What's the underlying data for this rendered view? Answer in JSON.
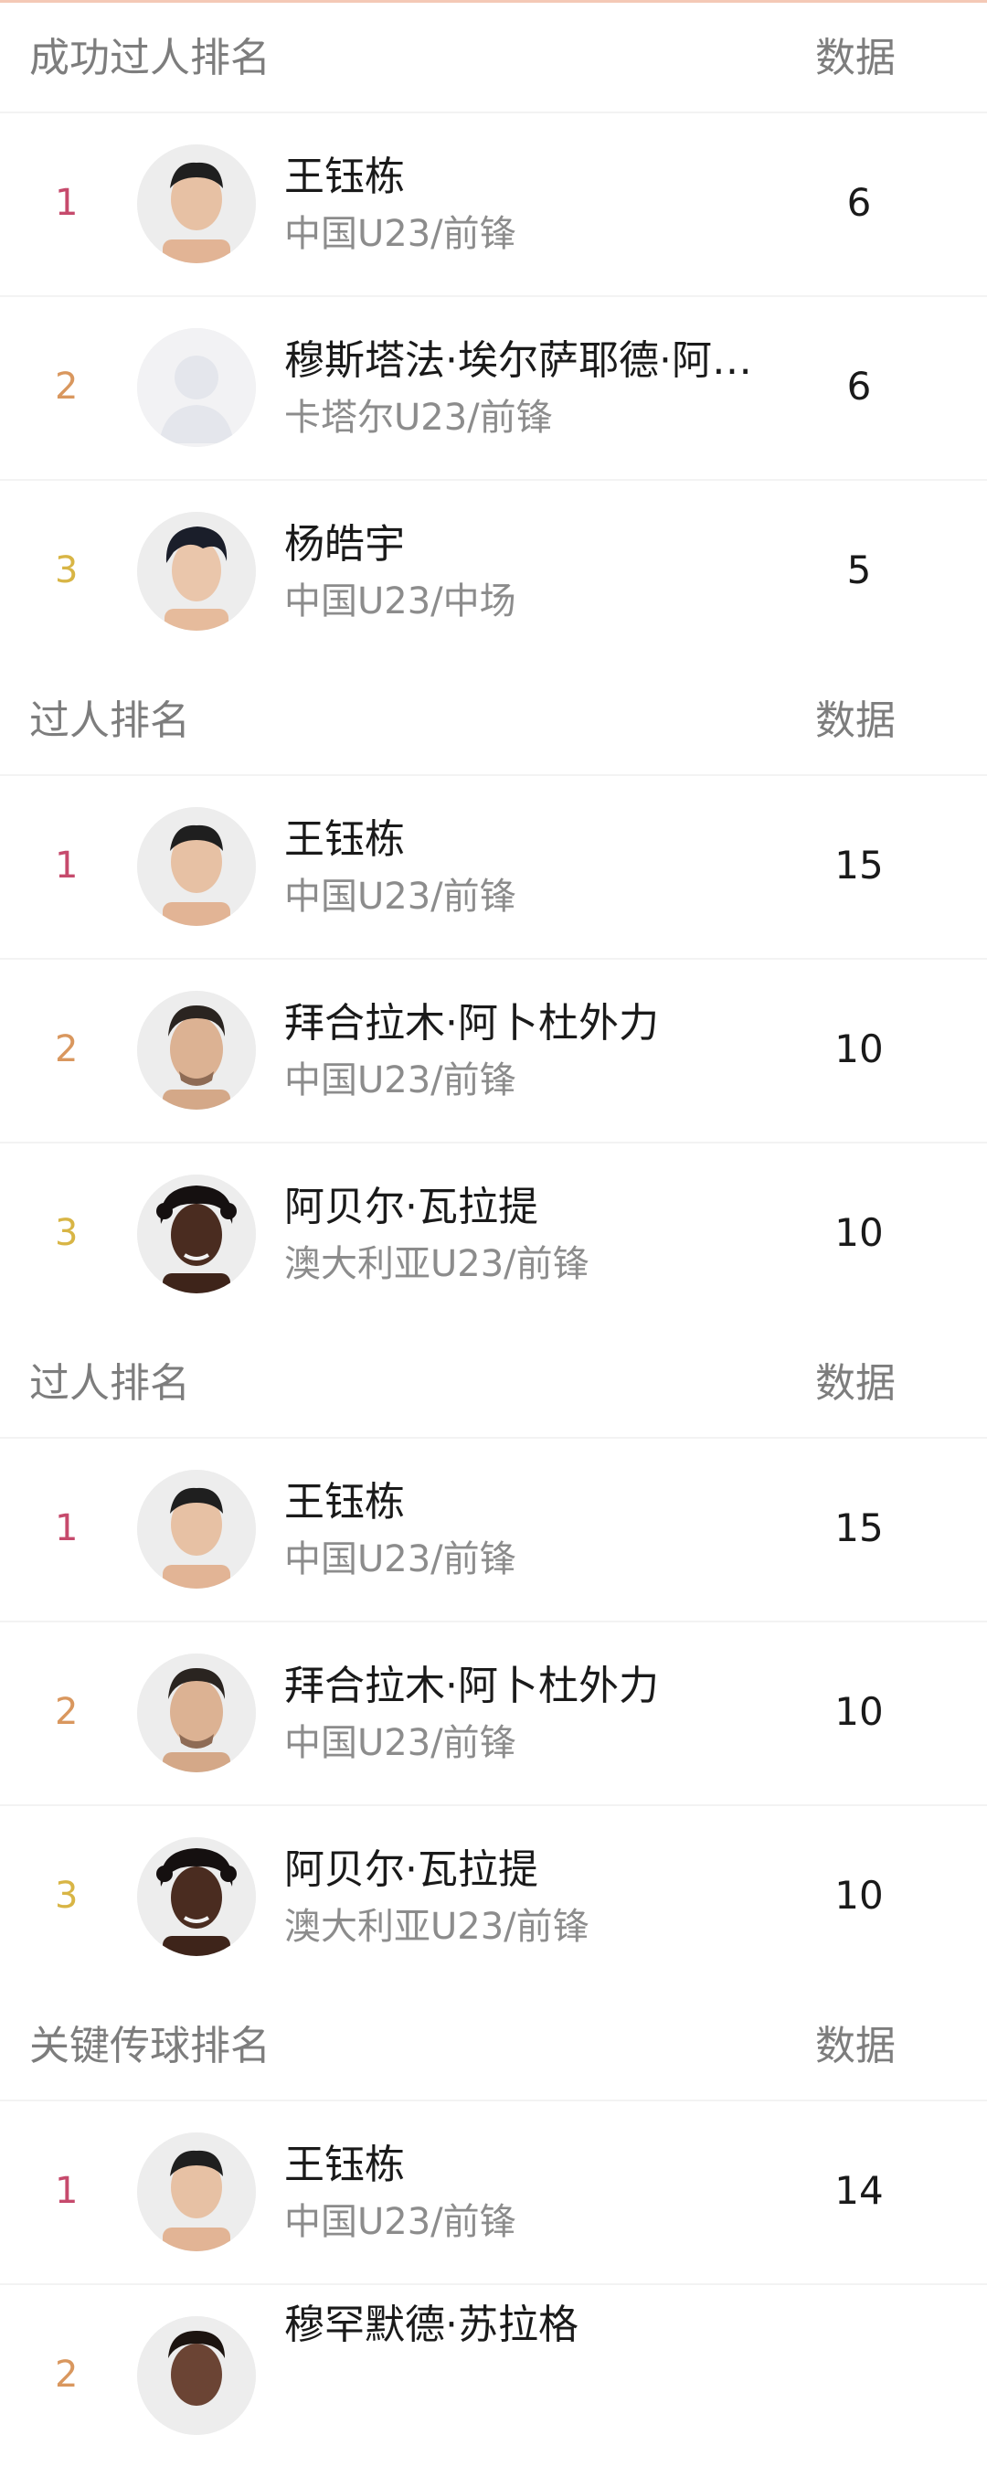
{
  "sections": [
    {
      "title": "成功过人排名",
      "data_label": "数据",
      "rows": [
        {
          "rank": "1",
          "name": "王钰栋",
          "team": "中国U23/前锋",
          "value": "6"
        },
        {
          "rank": "2",
          "name": "穆斯塔法·埃尔萨耶德·阿…",
          "team": "卡塔尔U23/前锋",
          "value": "6"
        },
        {
          "rank": "3",
          "name": "杨皓宇",
          "team": "中国U23/中场",
          "value": "5"
        }
      ]
    },
    {
      "title": "过人排名",
      "data_label": "数据",
      "rows": [
        {
          "rank": "1",
          "name": "王钰栋",
          "team": "中国U23/前锋",
          "value": "15"
        },
        {
          "rank": "2",
          "name": "拜合拉木·阿卜杜外力",
          "team": "中国U23/前锋",
          "value": "10"
        },
        {
          "rank": "3",
          "name": "阿贝尔·瓦拉提",
          "team": "澳大利亚U23/前锋",
          "value": "10"
        }
      ]
    },
    {
      "title": "过人排名",
      "data_label": "数据",
      "rows": [
        {
          "rank": "1",
          "name": "王钰栋",
          "team": "中国U23/前锋",
          "value": "15"
        },
        {
          "rank": "2",
          "name": "拜合拉木·阿卜杜外力",
          "team": "中国U23/前锋",
          "value": "10"
        },
        {
          "rank": "3",
          "name": "阿贝尔·瓦拉提",
          "team": "澳大利亚U23/前锋",
          "value": "10"
        }
      ]
    },
    {
      "title": "关键传球排名",
      "data_label": "数据",
      "rows": [
        {
          "rank": "1",
          "name": "王钰栋",
          "team": "中国U23/前锋",
          "value": "14"
        },
        {
          "rank": "2",
          "name": "穆罕默德·苏拉格",
          "team": "",
          "value": ""
        }
      ]
    }
  ],
  "colors": {
    "rank_1": "#c64a6c",
    "rank_2": "#d9975e",
    "rank_3": "#d8b545",
    "muted_text": "#7d7d7d",
    "divider": "#f3f3f3"
  },
  "icons": {
    "avatar": "player-avatar-photo",
    "placeholder": "default-person-silhouette-icon"
  }
}
